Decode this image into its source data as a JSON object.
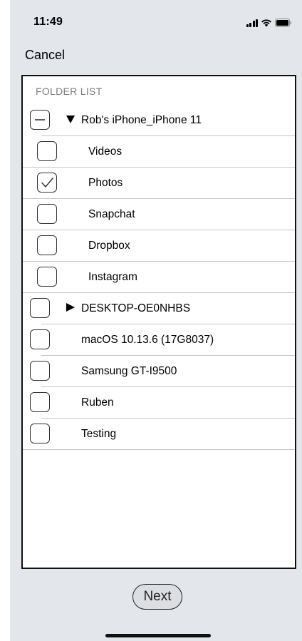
{
  "status_bar": {
    "time": "11:49",
    "icons": [
      "cellular-signal-icon",
      "wifi-icon",
      "battery-icon"
    ]
  },
  "nav": {
    "cancel_label": "Cancel"
  },
  "folder_list": {
    "header": "FOLDER LIST",
    "rows": [
      {
        "label": "Rob's iPhone_iPhone 11",
        "state": "partial",
        "disclosure": "expanded",
        "level": 0
      },
      {
        "label": "Videos",
        "state": "unchecked",
        "level": 1
      },
      {
        "label": "Photos",
        "state": "checked",
        "level": 1
      },
      {
        "label": "Snapchat",
        "state": "unchecked",
        "level": 1
      },
      {
        "label": "Dropbox",
        "state": "unchecked",
        "level": 1
      },
      {
        "label": "Instagram",
        "state": "unchecked",
        "level": 1
      },
      {
        "label": "DESKTOP-OE0NHBS",
        "state": "unchecked",
        "disclosure": "collapsed",
        "level": 0
      },
      {
        "label": "macOS 10.13.6 (17G8037)",
        "state": "unchecked",
        "level": 0
      },
      {
        "label": "Samsung GT-I9500",
        "state": "unchecked",
        "level": 0
      },
      {
        "label": "Ruben",
        "state": "unchecked",
        "level": 0
      },
      {
        "label": "Testing",
        "state": "unchecked",
        "level": 0
      }
    ]
  },
  "footer": {
    "next_label": "Next"
  },
  "colors": {
    "background": "#e3e6eb",
    "panel": "#ffffff",
    "header_text": "#7d7d82",
    "separator": "#c6c6c9"
  }
}
